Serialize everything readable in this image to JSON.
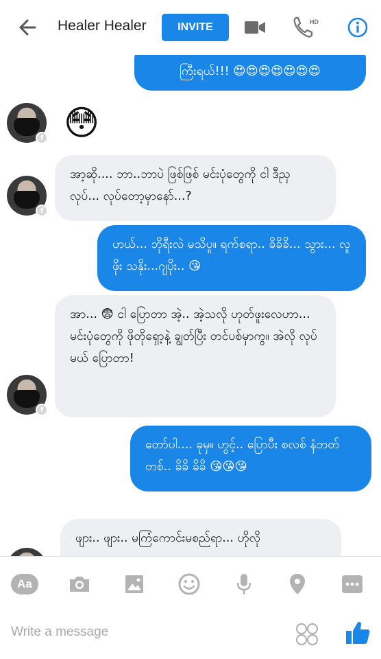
{
  "header": {
    "title": "Healer Healer",
    "invite_label": "INVITE"
  },
  "messages": [
    {
      "side": "out",
      "text": "ကြီးရယ်!!! 😍😍😍😍😍😍😍"
    },
    {
      "side": "in",
      "text": "😳"
    },
    {
      "side": "in",
      "text": "အာ့ဆို.... ဘာ..ဘာပဲ ဖြစ်ဖြစ် မင်းပုံတွေကို ငါ ဒီညှ လုပ်... လုပ်တော့မှာနော်...?"
    },
    {
      "side": "out",
      "text": "ဟယ်... ဘိုရီးလဲ မသိပူ။ ရက်စရာ.. ခိခိခိ... သွား... လူဖိုး သနိုး...ဂျပိုး.. 😘"
    },
    {
      "side": "in",
      "text": "အာ... 😨 ငါ ပြောတာ အဲ့.. အဲ့သလို ဟုတ်ဖူးလေဟာ... မင်းပုံတွေကို ဖိုတိုရှော့နဲ့ ချွတ်ပြီး တင်ပစ်မှာကွ။ အဲလို လုပ်မယ် ပြောတာ!"
    },
    {
      "side": "out",
      "text": "တော်ပါ.... ခုမှ။ ဟွင့်.. ပြောပီး စလစ် နံဘတ် တစ်.. ခိခိ ခိခိ 😘😘😘"
    },
    {
      "side": "in",
      "text": "ဖျား.. ဖျား.. မကြံကောင်းမစည်ရာ... ဟိုလို"
    }
  ],
  "composer": {
    "placeholder": "Write a message",
    "aa_label": "Aa"
  },
  "colors": {
    "accent": "#1a86e8",
    "incoming_bg": "#eeeff2",
    "icon_gray": "#b3b3b3"
  },
  "icons": [
    "back-arrow-icon",
    "video-call-icon",
    "hd-phone-icon",
    "info-icon",
    "camera-icon",
    "gallery-icon",
    "sticker-icon",
    "microphone-icon",
    "location-icon",
    "more-icon",
    "emoji-icon",
    "like-icon"
  ]
}
